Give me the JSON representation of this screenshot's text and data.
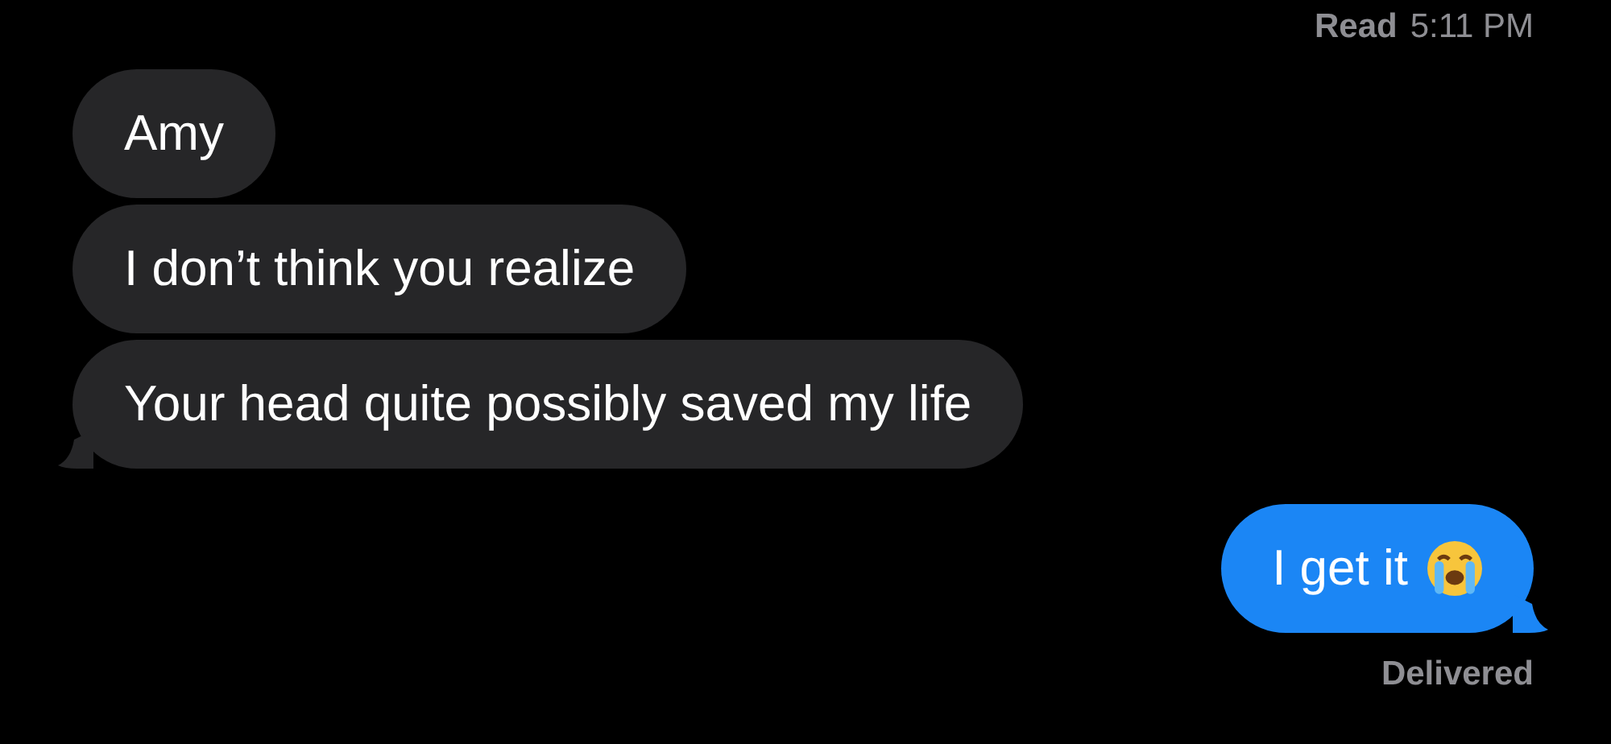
{
  "header": {
    "read_label": "Read",
    "time": "5:11 PM"
  },
  "messages": [
    {
      "text": "Amy",
      "kind": "incoming",
      "tail": false
    },
    {
      "text": "I don’t think you realize",
      "kind": "incoming",
      "tail": false
    },
    {
      "text": "Your head quite possibly saved my life",
      "kind": "incoming",
      "tail": true
    },
    {
      "text": "I get it",
      "kind": "outgoing",
      "tail": true,
      "emoji_icon": true
    }
  ],
  "status": "Delivered"
}
